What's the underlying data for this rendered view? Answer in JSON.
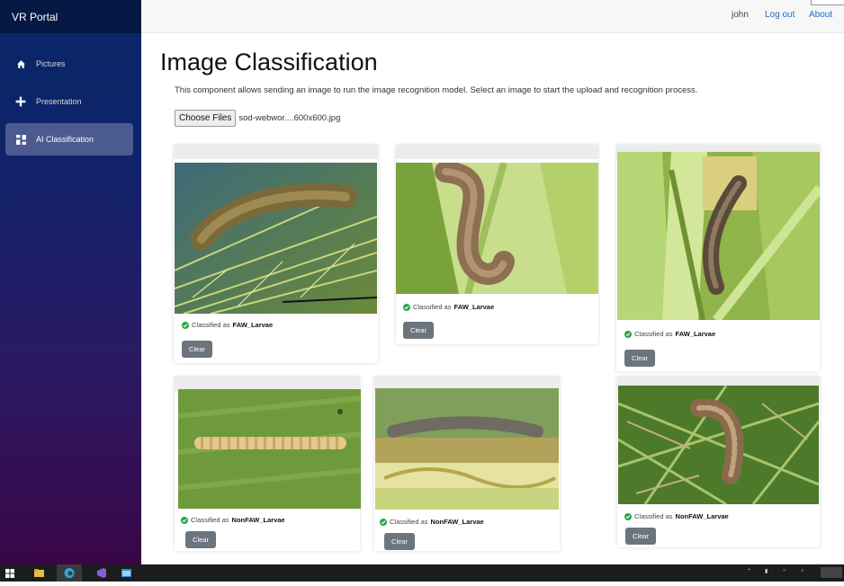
{
  "app": {
    "brand": "VR Portal"
  },
  "sidebar": {
    "items": [
      {
        "label": "Pictures",
        "icon": "home-icon"
      },
      {
        "label": "Presentation",
        "icon": "plus-icon"
      },
      {
        "label": "AI Classification",
        "icon": "grid-icon",
        "active": true
      }
    ]
  },
  "topbar": {
    "user": "john",
    "logout": "Log out",
    "about": "About"
  },
  "page": {
    "title": "Image Classification",
    "description": "This component allows sending an image to run the image recognition model. Select an image to start the upload and recognition process.",
    "file_button": "Choose Files",
    "file_name": "sod-webwor....600x600.jpg"
  },
  "results": [
    {
      "prefix": "Classified as",
      "label": "FAW_Larvae",
      "button": "Clear"
    },
    {
      "prefix": "Classified as",
      "label": "FAW_Larvae",
      "button": "Clear"
    },
    {
      "prefix": "Classified as",
      "label": "FAW_Larvae",
      "button": "Clear"
    },
    {
      "prefix": "Classified as",
      "label": "NonFAW_Larvae",
      "button": "Clear"
    },
    {
      "prefix": "Classified as",
      "label": "NonFAW_Larvae",
      "button": "Clear"
    },
    {
      "prefix": "Classified as",
      "label": "NonFAW_Larvae",
      "button": "Clear"
    }
  ],
  "colors": {
    "sidebar_top": "#052767",
    "sidebar_bottom": "#3a0647",
    "link": "#1b6ec2",
    "success": "#28a745",
    "clear_button": "#6c757d"
  }
}
